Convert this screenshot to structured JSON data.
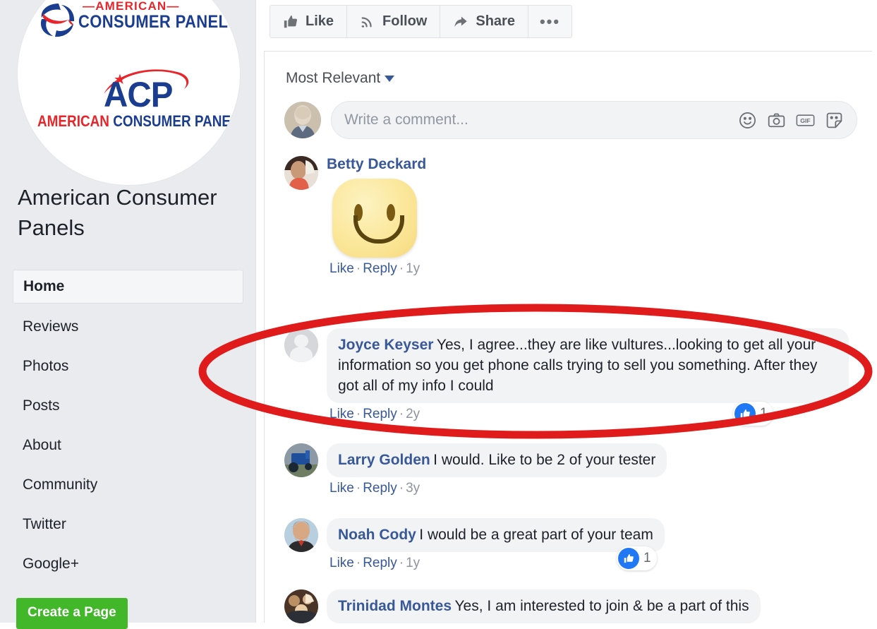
{
  "sidebar": {
    "logo": {
      "brand_top_line1": "—AMERICAN—",
      "brand_top_line2": "CONSUMER PANELS",
      "acp_mark": "ACP",
      "acp_sub_red": "AMERICAN",
      "acp_sub_blue": "CONSUMER PANELS"
    },
    "page_title": "American Consumer Panels",
    "items": [
      {
        "label": "Home",
        "active": true
      },
      {
        "label": "Reviews",
        "active": false
      },
      {
        "label": "Photos",
        "active": false
      },
      {
        "label": "Posts",
        "active": false
      },
      {
        "label": "About",
        "active": false
      },
      {
        "label": "Community",
        "active": false
      },
      {
        "label": "Twitter",
        "active": false
      },
      {
        "label": "Google+",
        "active": false
      }
    ],
    "create_page_label": "Create a Page"
  },
  "action_bar": {
    "like_label": "Like",
    "follow_label": "Follow",
    "share_label": "Share",
    "more_label": "•••"
  },
  "comments_panel": {
    "sort_label": "Most Relevant",
    "composer_placeholder": "Write a comment...",
    "composer_icons": [
      "emoji-icon",
      "camera-icon",
      "gif-icon",
      "sticker-icon"
    ],
    "meta": {
      "like": "Like",
      "reply": "Reply",
      "separator": "·"
    },
    "comments": [
      {
        "author": "Betty Deckard",
        "text": "",
        "is_emoji": true,
        "time": "1y",
        "likes": null,
        "avatar": "photo-woman"
      },
      {
        "author": "Joyce Keyser",
        "text": "Yes, I agree...they are like vultures...looking to get all your information so you get phone calls trying to sell you something. After they got all of my info I could",
        "is_emoji": false,
        "time": "2y",
        "likes": "1",
        "avatar": "default-silhouette",
        "highlighted": true
      },
      {
        "author": "Larry Golden",
        "text": "I would. Like to be 2 of your tester",
        "is_emoji": false,
        "time": "3y",
        "likes": null,
        "avatar": "photo-tractor"
      },
      {
        "author": "Noah Cody",
        "text": "I would be a great part of your team",
        "is_emoji": false,
        "time": "1y",
        "likes": "1",
        "avatar": "photo-man"
      },
      {
        "author": "Trinidad Montes",
        "text": "Yes, I am interested to join & be a part of this",
        "is_emoji": false,
        "time": "",
        "likes": null,
        "avatar": "photo-group"
      }
    ]
  },
  "annotation": {
    "type": "ellipse-highlight",
    "color": "#e01b1b",
    "target": "Joyce Keyser comment"
  },
  "colors": {
    "sidebar_bg": "#e9ebee",
    "brand_blue": "#1b3d8f",
    "brand_red": "#e8252a",
    "link_blue": "#385898",
    "green_button": "#42b72a",
    "like_blue": "#2078f4",
    "bubble_gray": "#f2f3f5"
  }
}
